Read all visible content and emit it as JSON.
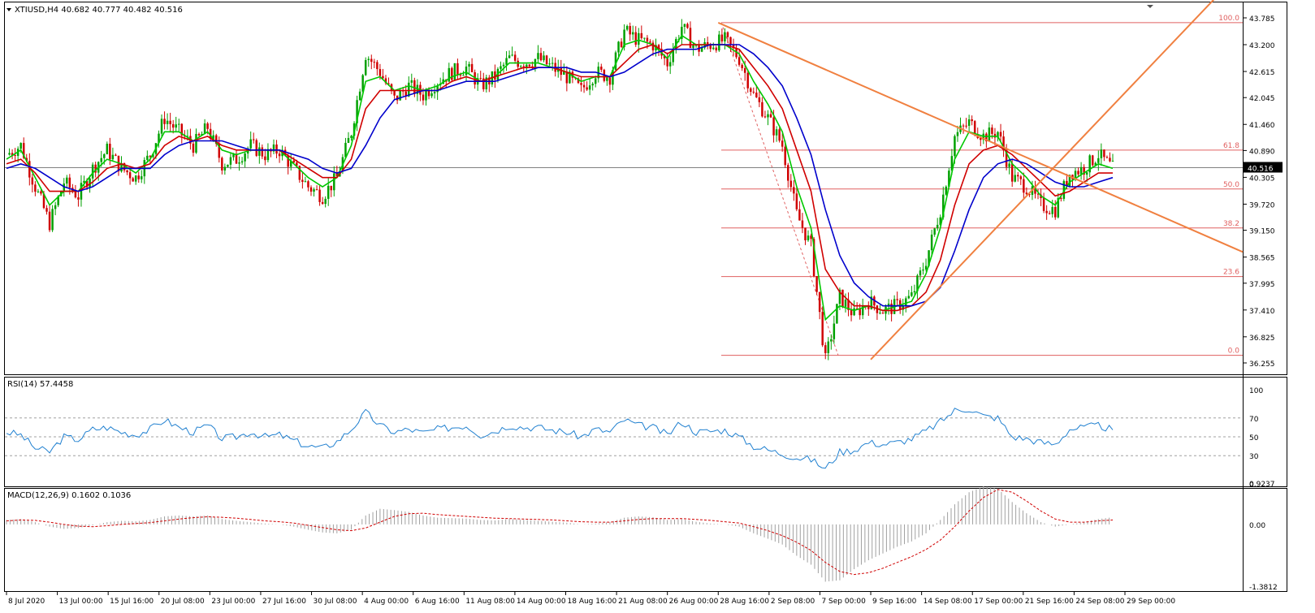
{
  "header": {
    "symbol_line": "XTIUSD,H4  40.682 40.777 40.482 40.516"
  },
  "rsi_panel": {
    "label": "RSI(14) 57.4458"
  },
  "macd_panel": {
    "label": "MACD(12,26,9) 0.1602 0.1036"
  },
  "colors": {
    "bull": "#00a000",
    "bear": "#d00000",
    "ma_fast": "#00c800",
    "ma_mid": "#d00000",
    "ma_slow": "#0000cc",
    "fib": "#e06060",
    "trend": "#f08040",
    "rsi": "#2080d0",
    "macd_hist": "#a0a0a0",
    "macd_signal": "#d00000"
  },
  "chart_data": [
    {
      "type": "line",
      "panel": "price",
      "title": "XTIUSD,H4  40.682 40.777 40.482 40.516",
      "ylim": [
        36.255,
        43.785
      ],
      "y_ticks": [
        "43.785",
        "43.200",
        "42.615",
        "42.045",
        "41.460",
        "40.890",
        "40.305",
        "39.720",
        "39.150",
        "38.565",
        "37.995",
        "37.410",
        "36.825",
        "36.255"
      ],
      "current_price": "40.516",
      "x_ticks": [
        "8 Jul 2020",
        "13 Jul 00:00",
        "15 Jul 16:00",
        "20 Jul 08:00",
        "23 Jul 00:00",
        "27 Jul 16:00",
        "30 Jul 08:00",
        "4 Aug 00:00",
        "6 Aug 16:00",
        "11 Aug 08:00",
        "14 Aug 00:00",
        "18 Aug 16:00",
        "21 Aug 08:00",
        "26 Aug 00:00",
        "28 Aug 16:00",
        "2 Sep 08:00",
        "7 Sep 00:00",
        "9 Sep 16:00",
        "14 Sep 08:00",
        "17 Sep 00:00",
        "21 Sep 16:00",
        "24 Sep 08:00",
        "29 Sep 00:00"
      ],
      "close_path": [
        40.8,
        41.0,
        40.1,
        39.3,
        40.2,
        39.9,
        40.5,
        40.9,
        40.5,
        40.3,
        40.8,
        41.6,
        41.3,
        41.0,
        41.4,
        40.6,
        40.7,
        41.0,
        40.8,
        40.9,
        40.5,
        40.1,
        39.9,
        40.3,
        41.3,
        43.0,
        42.6,
        42.0,
        42.3,
        42.1,
        42.4,
        42.6,
        42.7,
        42.3,
        42.5,
        42.9,
        42.8,
        42.9,
        42.7,
        42.5,
        42.2,
        42.6,
        42.5,
        43.5,
        43.3,
        43.2,
        42.8,
        43.6,
        43.1,
        43.2,
        43.3,
        42.9,
        42.1,
        41.6,
        41.0,
        39.5,
        38.8,
        36.3,
        37.7,
        37.3,
        37.6,
        37.4,
        37.5,
        37.7,
        38.5,
        39.6,
        41.2,
        41.5,
        41.2,
        41.3,
        40.3,
        40.1,
        39.7,
        39.6,
        40.4,
        40.5,
        40.8,
        40.5
      ],
      "series": [
        {
          "values": [
            40.7,
            40.9,
            40.3,
            39.7,
            40.0,
            40.0,
            40.4,
            40.7,
            40.6,
            40.4,
            40.7,
            41.3,
            41.3,
            41.1,
            41.3,
            40.9,
            40.8,
            40.9,
            40.9,
            40.9,
            40.6,
            40.3,
            40.1,
            40.3,
            41.0,
            42.4,
            42.5,
            42.2,
            42.3,
            42.2,
            42.3,
            42.5,
            42.6,
            42.4,
            42.5,
            42.8,
            42.8,
            42.8,
            42.7,
            42.6,
            42.4,
            42.5,
            42.5,
            43.2,
            43.3,
            43.2,
            42.9,
            43.4,
            43.2,
            43.2,
            43.2,
            43.0,
            42.4,
            41.9,
            41.3,
            40.1,
            39.2,
            37.2,
            37.5,
            37.4,
            37.5,
            37.4,
            37.5,
            37.6,
            38.2,
            39.2,
            40.7,
            41.3,
            41.2,
            41.2,
            40.6,
            40.3,
            39.9,
            39.7,
            40.2,
            40.4,
            40.6,
            40.5
          ]
        },
        {
          "values": [
            40.6,
            40.7,
            40.4,
            40.0,
            40.0,
            40.0,
            40.2,
            40.5,
            40.6,
            40.5,
            40.6,
            41.0,
            41.2,
            41.1,
            41.2,
            41.0,
            40.9,
            40.9,
            40.9,
            40.9,
            40.7,
            40.5,
            40.3,
            40.3,
            40.7,
            41.8,
            42.2,
            42.2,
            42.2,
            42.2,
            42.2,
            42.4,
            42.5,
            42.4,
            42.5,
            42.6,
            42.7,
            42.7,
            42.7,
            42.6,
            42.5,
            42.5,
            42.5,
            42.8,
            43.1,
            43.2,
            43.0,
            43.2,
            43.2,
            43.2,
            43.2,
            43.1,
            42.7,
            42.3,
            41.8,
            40.9,
            40.0,
            38.3,
            37.8,
            37.5,
            37.5,
            37.4,
            37.4,
            37.5,
            37.8,
            38.5,
            39.7,
            40.6,
            40.9,
            41.0,
            40.8,
            40.5,
            40.2,
            39.9,
            40.0,
            40.2,
            40.4,
            40.4
          ]
        },
        {
          "values": [
            40.5,
            40.6,
            40.5,
            40.3,
            40.1,
            40.0,
            40.1,
            40.3,
            40.5,
            40.5,
            40.5,
            40.8,
            41.0,
            41.1,
            41.1,
            41.1,
            41.0,
            40.9,
            40.9,
            40.9,
            40.8,
            40.7,
            40.5,
            40.4,
            40.5,
            41.0,
            41.6,
            42.0,
            42.1,
            42.2,
            42.2,
            42.3,
            42.4,
            42.4,
            42.4,
            42.5,
            42.6,
            42.7,
            42.7,
            42.7,
            42.6,
            42.6,
            42.5,
            42.6,
            42.8,
            43.0,
            43.1,
            43.1,
            43.1,
            43.2,
            43.2,
            43.2,
            43.0,
            42.7,
            42.3,
            41.6,
            40.8,
            39.6,
            38.6,
            38.0,
            37.7,
            37.5,
            37.5,
            37.5,
            37.6,
            37.9,
            38.7,
            39.6,
            40.3,
            40.6,
            40.7,
            40.6,
            40.4,
            40.2,
            40.1,
            40.1,
            40.2,
            40.3
          ]
        }
      ],
      "fibonacci_levels": [
        {
          "label": "100.0",
          "value": 43.68
        },
        {
          "label": "61.8",
          "value": 40.9
        },
        {
          "label": "50.0",
          "value": 40.05
        },
        {
          "label": "38.2",
          "value": 39.2
        },
        {
          "label": "23.6",
          "value": 38.14
        },
        {
          "label": "0.0",
          "value": 36.42
        }
      ],
      "trendlines": [
        {
          "from": [
            "28 Aug 16:00",
            43.68
          ],
          "to": [
            "29 Sep 00:00",
            39.8
          ]
        },
        {
          "from": [
            "9 Sep 16:00",
            36.33
          ],
          "to": [
            "29 Sep 00:00",
            42.15
          ]
        }
      ]
    },
    {
      "type": "line",
      "panel": "rsi",
      "title": "RSI(14) 57.4458",
      "ylim": [
        0,
        100
      ],
      "y_ticks": [
        "100",
        "70",
        "50",
        "30",
        "0"
      ],
      "levels": [
        70,
        50,
        30
      ],
      "values": [
        55,
        52,
        38,
        34,
        50,
        47,
        58,
        60,
        55,
        52,
        58,
        68,
        60,
        55,
        62,
        48,
        50,
        55,
        50,
        52,
        46,
        40,
        38,
        45,
        58,
        76,
        62,
        55,
        58,
        54,
        58,
        60,
        62,
        52,
        56,
        62,
        60,
        60,
        57,
        55,
        50,
        58,
        55,
        68,
        62,
        60,
        52,
        66,
        55,
        56,
        57,
        50,
        40,
        36,
        32,
        28,
        26,
        16,
        34,
        36,
        44,
        42,
        44,
        48,
        56,
        66,
        78,
        80,
        72,
        70,
        50,
        48,
        44,
        42,
        58,
        60,
        62,
        57.4
      ]
    },
    {
      "type": "bar",
      "panel": "macd",
      "title": "MACD(12,26,9) 0.1602 0.1036",
      "ylim": [
        -1.3812,
        0.9237
      ],
      "y_ticks": [
        "0.9237",
        "0.00",
        "-1.3812"
      ],
      "values": [
        0.1,
        0.12,
        0.05,
        -0.05,
        -0.1,
        -0.08,
        -0.02,
        0.05,
        0.08,
        0.07,
        0.1,
        0.18,
        0.2,
        0.18,
        0.2,
        0.12,
        0.08,
        0.05,
        0.02,
        0.0,
        -0.05,
        -0.12,
        -0.18,
        -0.2,
        -0.12,
        0.2,
        0.35,
        0.32,
        0.28,
        0.2,
        0.15,
        0.14,
        0.13,
        0.1,
        0.09,
        0.12,
        0.1,
        0.08,
        0.06,
        0.04,
        0.0,
        0.02,
        0.05,
        0.15,
        0.18,
        0.16,
        0.1,
        0.12,
        0.06,
        0.02,
        0.0,
        -0.05,
        -0.2,
        -0.32,
        -0.45,
        -0.7,
        -0.9,
        -1.28,
        -1.25,
        -1.0,
        -0.8,
        -0.65,
        -0.5,
        -0.38,
        -0.2,
        0.1,
        0.45,
        0.72,
        0.85,
        0.8,
        0.5,
        0.25,
        0.05,
        -0.05,
        0.0,
        0.05,
        0.12,
        0.16
      ],
      "signal": [
        0.08,
        0.1,
        0.09,
        0.05,
        0.0,
        -0.04,
        -0.05,
        -0.03,
        0.0,
        0.02,
        0.04,
        0.08,
        0.12,
        0.15,
        0.17,
        0.16,
        0.14,
        0.11,
        0.08,
        0.06,
        0.03,
        -0.02,
        -0.07,
        -0.12,
        -0.14,
        -0.08,
        0.05,
        0.18,
        0.24,
        0.25,
        0.22,
        0.2,
        0.18,
        0.16,
        0.14,
        0.13,
        0.12,
        0.11,
        0.1,
        0.08,
        0.06,
        0.05,
        0.05,
        0.08,
        0.11,
        0.13,
        0.13,
        0.13,
        0.11,
        0.09,
        0.06,
        0.03,
        -0.05,
        -0.14,
        -0.25,
        -0.4,
        -0.58,
        -0.85,
        -1.05,
        -1.12,
        -1.08,
        -0.98,
        -0.85,
        -0.72,
        -0.56,
        -0.35,
        -0.05,
        0.3,
        0.6,
        0.78,
        0.72,
        0.52,
        0.3,
        0.12,
        0.05,
        0.05,
        0.08,
        0.1
      ]
    }
  ]
}
